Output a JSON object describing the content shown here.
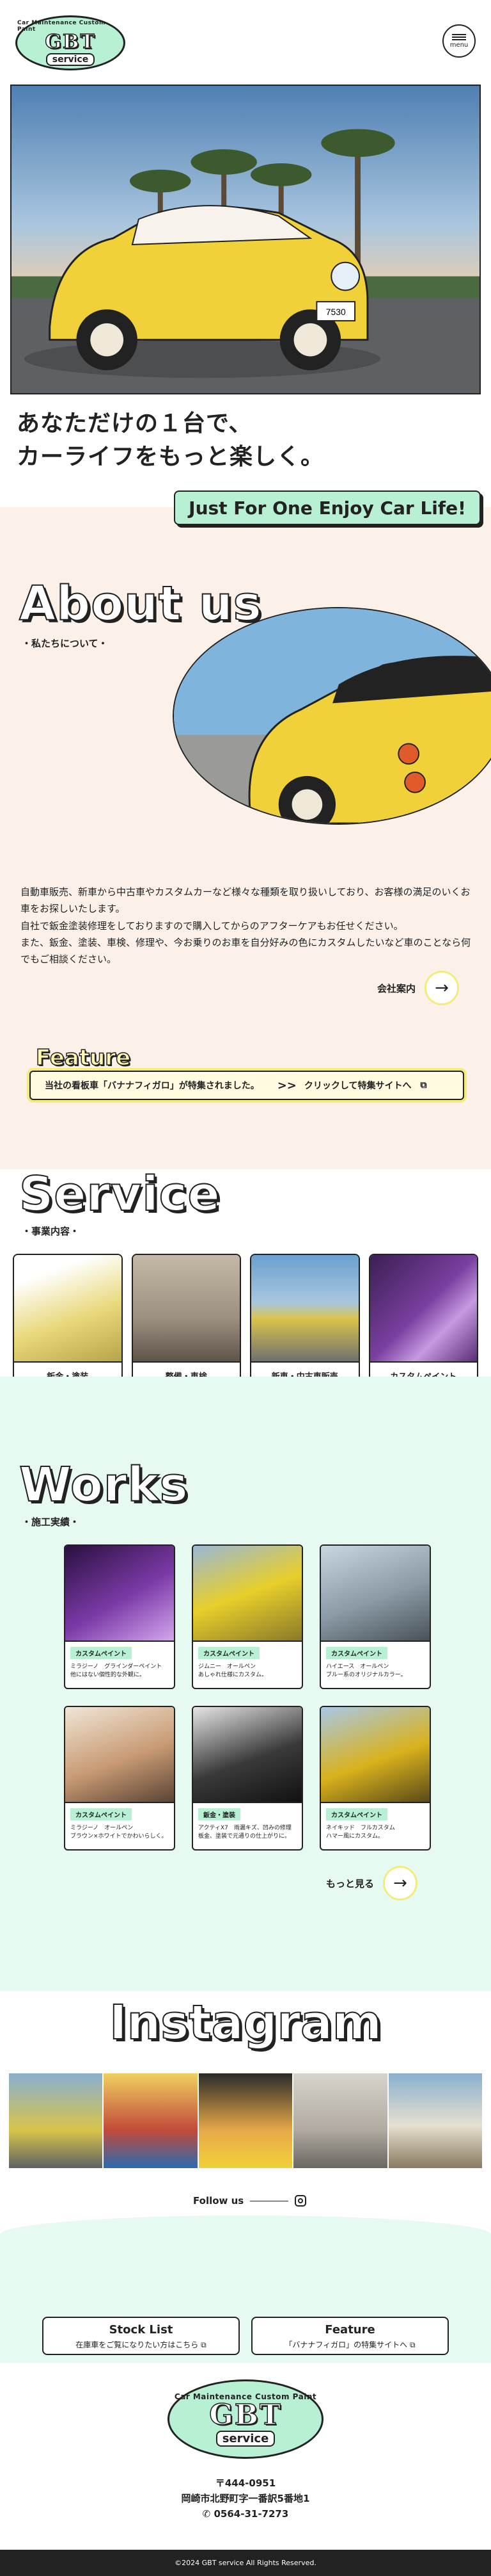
{
  "header": {
    "logo_arc": "Car Maintenance Custom Paint",
    "logo_main": "GBT",
    "logo_sub": "service",
    "menu_label": "menu"
  },
  "hero": {
    "tagline_line1": "あなただけの１台で、",
    "tagline_line2": "カーライフをもっと楽しく。",
    "badge": "Just For One Enjoy Car Life!",
    "plate": "7530"
  },
  "about": {
    "title": "About us",
    "subtitle": "・私たちについて・",
    "text_1": "自動車販売、新車から中古車やカスタムカーなど様々な種類を取り扱いしており、お客様の満足のいくお車をお探しいたします。",
    "text_2": "自社で鈑金塗装修理をしておりますので購入してからのアフターケアもお任せください。",
    "text_3": "また、鈑金、塗装、車検、修理や、今お乗りのお車を自分好みの色にカスタムしたいなど車のことなら何でもご相談ください。",
    "company_link": "会社案内"
  },
  "feature": {
    "title": "Feature",
    "banner_text": "当社の看板車「バナナフィガロ」が特集されました。",
    "banner_link": "クリックして特集サイトへ"
  },
  "service": {
    "title": "Service",
    "subtitle": "・事業内容・",
    "items": [
      {
        "label": "鈑金・塗装",
        "color": "#e8d87a"
      },
      {
        "label": "整備・車検",
        "color": "#9b8f80"
      },
      {
        "label": "新車・中古車販売",
        "color": "#6aa0cf"
      },
      {
        "label": "カスタムペイント",
        "color": "#7a3fa0"
      }
    ]
  },
  "works": {
    "title": "Works",
    "subtitle": "・施工実績・",
    "items": [
      {
        "tag": "カスタムペイント",
        "line1": "ミラジーノ　グラインダーペイント",
        "line2": "他にはない個性的な外観に。",
        "color": "#7b3aa6"
      },
      {
        "tag": "カスタムペイント",
        "line1": "ジムニー　オールペン",
        "line2": "あしゃれ仕様にカスタム。",
        "color": "#e8cf2a"
      },
      {
        "tag": "カスタムペイント",
        "line1": "ハイエース　オールペン",
        "line2": "ブルー系のオリジナルカラー。",
        "color": "#8a9aa6"
      },
      {
        "tag": "カスタムペイント",
        "line1": "ミラジーノ　オールペン",
        "line2": "ブラウン×ホワイトでかわいらしく。",
        "color": "#c89a74"
      },
      {
        "tag": "鈑金・塗装",
        "line1": "アクティX7　雨漏キズ、凹みの修理",
        "line2": "板金、塗装で元通りの仕上がりに。",
        "color": "#3a3a3a"
      },
      {
        "tag": "カスタムペイント",
        "line1": "ネイキッド　フルカスタム",
        "line2": "ハマー風にカスタム。",
        "color": "#d9b21c"
      }
    ],
    "more_link": "もっと見る"
  },
  "instagram": {
    "title": "Instagram",
    "follow": "Follow us",
    "photos": [
      "#d9c44a",
      "#c24a3a",
      "#e6a948",
      "#b0aaa0",
      "#8ab0d0"
    ]
  },
  "bottom_links": [
    {
      "title": "Stock List",
      "sub": "在庫車をご覧になりたい方はこちら"
    },
    {
      "title": "Feature",
      "sub": "「バナナフィガロ」の特集サイトへ"
    }
  ],
  "footer": {
    "postal": "〒444-0951",
    "address": "岡崎市北野町字一番訳5番地1",
    "phone": "0564-31-7273",
    "copyright": "©2024 GBT service All Rights Reserved."
  },
  "colors": {
    "mint": "#b8f0d4",
    "cream": "#fbf1e8",
    "works_bg": "#e7faf1",
    "accent_yellow": "#f3ec7a"
  }
}
